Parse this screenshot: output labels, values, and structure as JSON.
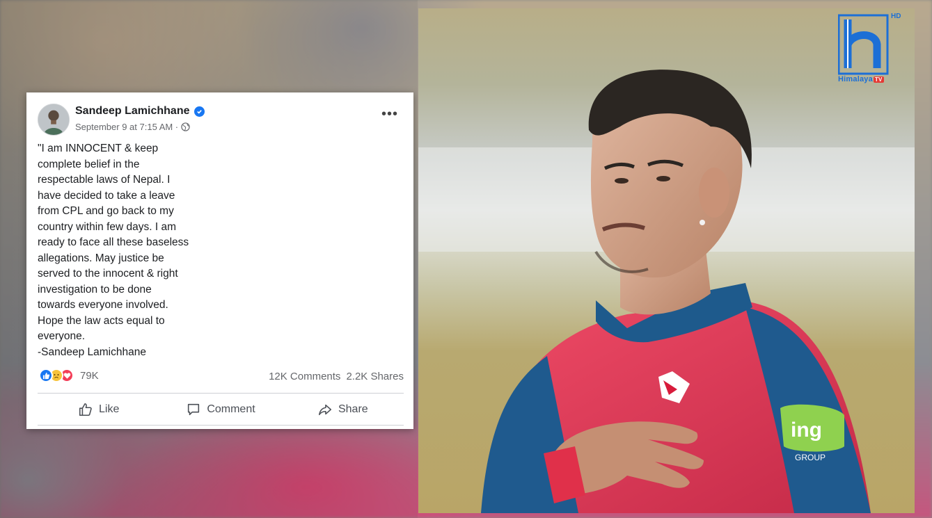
{
  "post": {
    "author": "Sandeep Lamichhane",
    "timestamp": "September 9 at 7:15 AM ·",
    "more_icon": "•••",
    "text": "\"I am INNOCENT & keep\ncomplete belief in the\nrespectable laws of Nepal. I\nhave decided to take a leave\nfrom CPL and go back to my\ncountry within few days. I am\nready to face all these baseless\nallegations. May justice be\nserved to the innocent & right\ninvestigation to be done\ntowards everyone involved.\nHope the law acts equal to\neveryone.\n-Sandeep Lamichhane",
    "reaction_count": "79K",
    "comments": "12K Comments",
    "shares": "2.2K Shares",
    "actions": {
      "like": "Like",
      "comment": "Comment",
      "share": "Share"
    },
    "icons": [
      "verified-badge-icon",
      "globe-icon",
      "like-reaction-icon",
      "sad-reaction-icon",
      "love-reaction-icon",
      "thumbs-up-icon",
      "comment-bubble-icon",
      "share-arrow-icon"
    ]
  },
  "branding": {
    "channel": "Himalaya",
    "channel_suffix": "TV",
    "hd": "HD",
    "accent": "#1c6fd6"
  },
  "colors": {
    "facebook_blue": "#1877f2",
    "jersey_red": "#e23b55",
    "jersey_blue": "#1e5a8c"
  }
}
